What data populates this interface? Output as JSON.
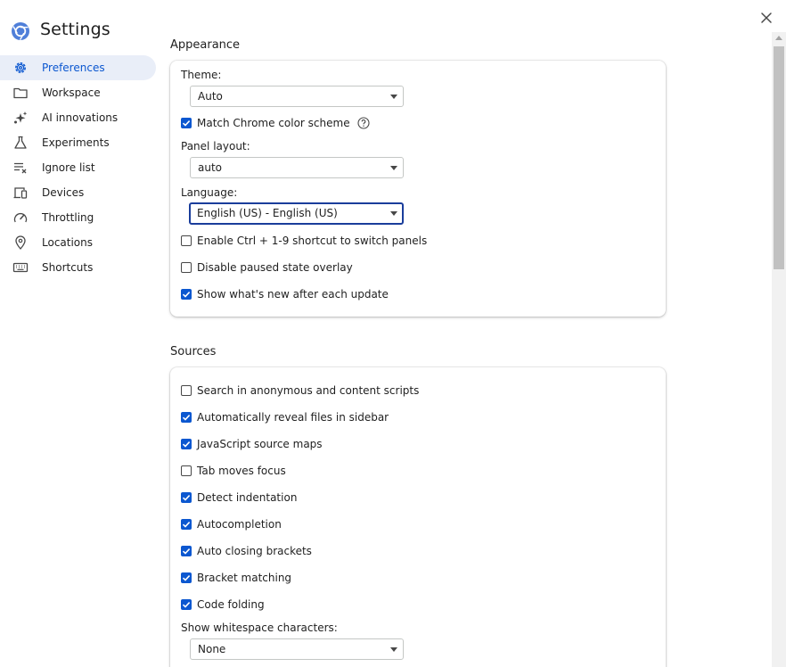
{
  "header": {
    "title": "Settings",
    "logo_icon": "chrome-devtools-logo-icon",
    "close_icon": "close-icon"
  },
  "nav": {
    "items": [
      {
        "label": "Preferences",
        "icon": "gear-icon",
        "active": true
      },
      {
        "label": "Workspace",
        "icon": "folder-icon",
        "active": false
      },
      {
        "label": "AI innovations",
        "icon": "sparkle-icon",
        "active": false
      },
      {
        "label": "Experiments",
        "icon": "flask-icon",
        "active": false
      },
      {
        "label": "Ignore list",
        "icon": "ignore-list-icon",
        "active": false
      },
      {
        "label": "Devices",
        "icon": "devices-icon",
        "active": false
      },
      {
        "label": "Throttling",
        "icon": "speedometer-icon",
        "active": false
      },
      {
        "label": "Locations",
        "icon": "location-pin-icon",
        "active": false
      },
      {
        "label": "Shortcuts",
        "icon": "keyboard-icon",
        "active": false
      }
    ]
  },
  "appearance": {
    "title": "Appearance",
    "theme_label": "Theme:",
    "theme_value": "Auto",
    "match_chrome": {
      "label": "Match Chrome color scheme",
      "checked": true
    },
    "panel_layout_label": "Panel layout:",
    "panel_layout_value": "auto",
    "language_label": "Language:",
    "language_value": "English (US) - English (US)",
    "ctrl_shortcut": {
      "label": "Enable Ctrl + 1-9 shortcut to switch panels",
      "checked": false
    },
    "disable_paused": {
      "label": "Disable paused state overlay",
      "checked": false
    },
    "whats_new": {
      "label": "Show what's new after each update",
      "checked": true
    }
  },
  "sources": {
    "title": "Sources",
    "options": [
      {
        "label": "Search in anonymous and content scripts",
        "checked": false
      },
      {
        "label": "Automatically reveal files in sidebar",
        "checked": true
      },
      {
        "label": "JavaScript source maps",
        "checked": true
      },
      {
        "label": "Tab moves focus",
        "checked": false
      },
      {
        "label": "Detect indentation",
        "checked": true
      },
      {
        "label": "Autocompletion",
        "checked": true
      },
      {
        "label": "Auto closing brackets",
        "checked": true
      },
      {
        "label": "Bracket matching",
        "checked": true
      },
      {
        "label": "Code folding",
        "checked": true
      }
    ],
    "whitespace_label": "Show whitespace characters:",
    "whitespace_value": "None"
  },
  "colors": {
    "accent": "#0b57d0",
    "active_bg": "#e9eef8",
    "focus_border": "#1a3d9b"
  }
}
